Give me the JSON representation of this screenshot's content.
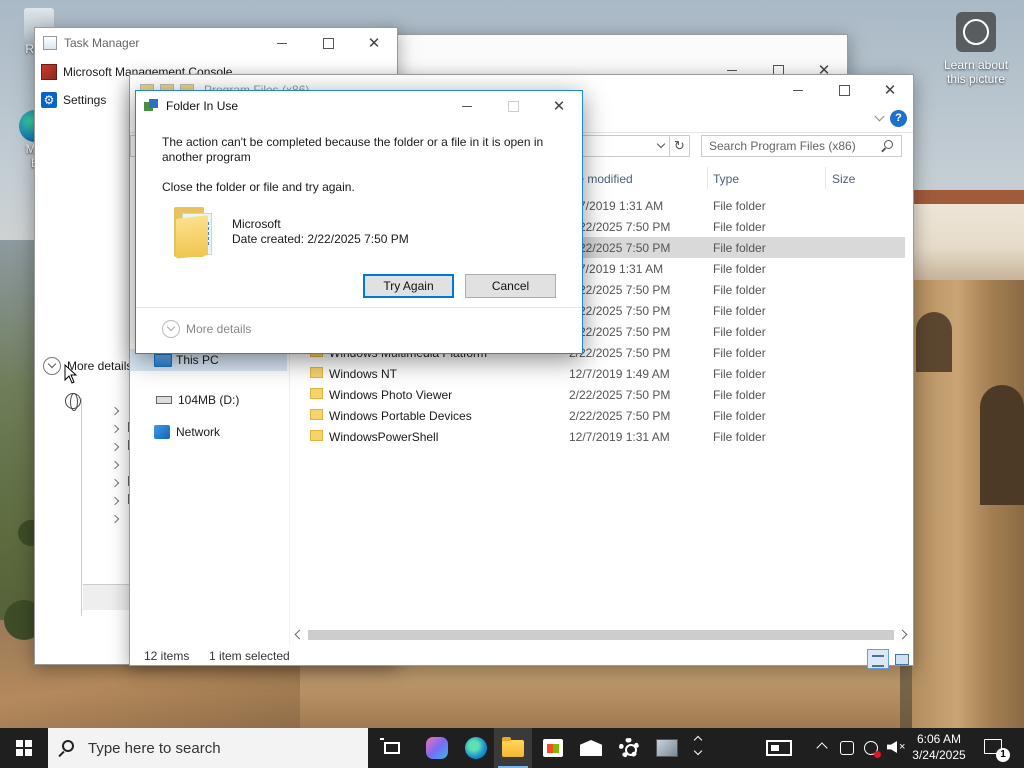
{
  "desktop": {
    "recycle_label": "Recy",
    "edge_label_1": "Mic",
    "edge_label_2": "E",
    "learn_label": "Learn about this picture"
  },
  "back_window": {
    "title": ""
  },
  "task_manager": {
    "title": "Task Manager",
    "items": [
      {
        "label": "Microsoft Management Console",
        "icon": "mmc-icon"
      },
      {
        "label": "Settings",
        "icon": "gear-icon"
      }
    ],
    "more_details": "More details"
  },
  "explorer": {
    "title": "Program Files (x86)",
    "search_placeholder": "Search Program Files (x86)",
    "columns": {
      "date": "te modified",
      "type": "Type",
      "size": "Size"
    },
    "nav": [
      {
        "label": "This PC",
        "icon": "pc-icon"
      },
      {
        "label": "104MB (D:)",
        "icon": "drive-icon"
      },
      {
        "label": "Network",
        "icon": "network-icon"
      }
    ],
    "rows": [
      {
        "name": "",
        "date": "7/7/2019 1:31 AM",
        "type": "File folder"
      },
      {
        "name": "",
        "date": "2/22/2025 7:50 PM",
        "type": "File folder"
      },
      {
        "name": "",
        "date": "2/22/2025 7:50 PM",
        "type": "File folder"
      },
      {
        "name": "",
        "date": "7/7/2019 1:31 AM",
        "type": "File folder"
      },
      {
        "name": "",
        "date": "2/22/2025 7:50 PM",
        "type": "File folder"
      },
      {
        "name": "",
        "date": "2/22/2025 7:50 PM",
        "type": "File folder"
      },
      {
        "name": "",
        "date": "2/22/2025 7:50 PM",
        "type": "File folder"
      },
      {
        "name": "Windows Multimedia Platform",
        "date": "2/22/2025 7:50 PM",
        "type": "File folder"
      },
      {
        "name": "Windows NT",
        "date": "12/7/2019 1:49 AM",
        "type": "File folder"
      },
      {
        "name": "Windows Photo Viewer",
        "date": "2/22/2025 7:50 PM",
        "type": "File folder"
      },
      {
        "name": "Windows Portable Devices",
        "date": "2/22/2025 7:50 PM",
        "type": "File folder"
      },
      {
        "name": "WindowsPowerShell",
        "date": "12/7/2019 1:31 AM",
        "type": "File folder"
      }
    ],
    "selected_row": 2,
    "status_items": "12 items",
    "status_selected": "1 item selected"
  },
  "dialog": {
    "title": "Folder In Use",
    "message": "The action can't be completed because the folder or a file in it is open in another program",
    "hint": "Close the folder or file and try again.",
    "folder_name": "Microsoft",
    "folder_date": "Date created: 2/22/2025 7:50 PM",
    "try_again": "Try Again",
    "cancel": "Cancel",
    "more_details": "More details"
  },
  "taskbar": {
    "search_placeholder": "Type here to search",
    "time": "6:06 AM",
    "date": "3/24/2025",
    "notification_count": "1",
    "apps": [
      "task-view",
      "copilot",
      "edge",
      "file-explorer",
      "store",
      "mail",
      "settings",
      "server-manager"
    ]
  },
  "colors": {
    "accent": "#0078d7",
    "selection": "#d9d9d9",
    "nav_selection": "#d9e8f7",
    "taskbar": "#1f1f1f"
  }
}
